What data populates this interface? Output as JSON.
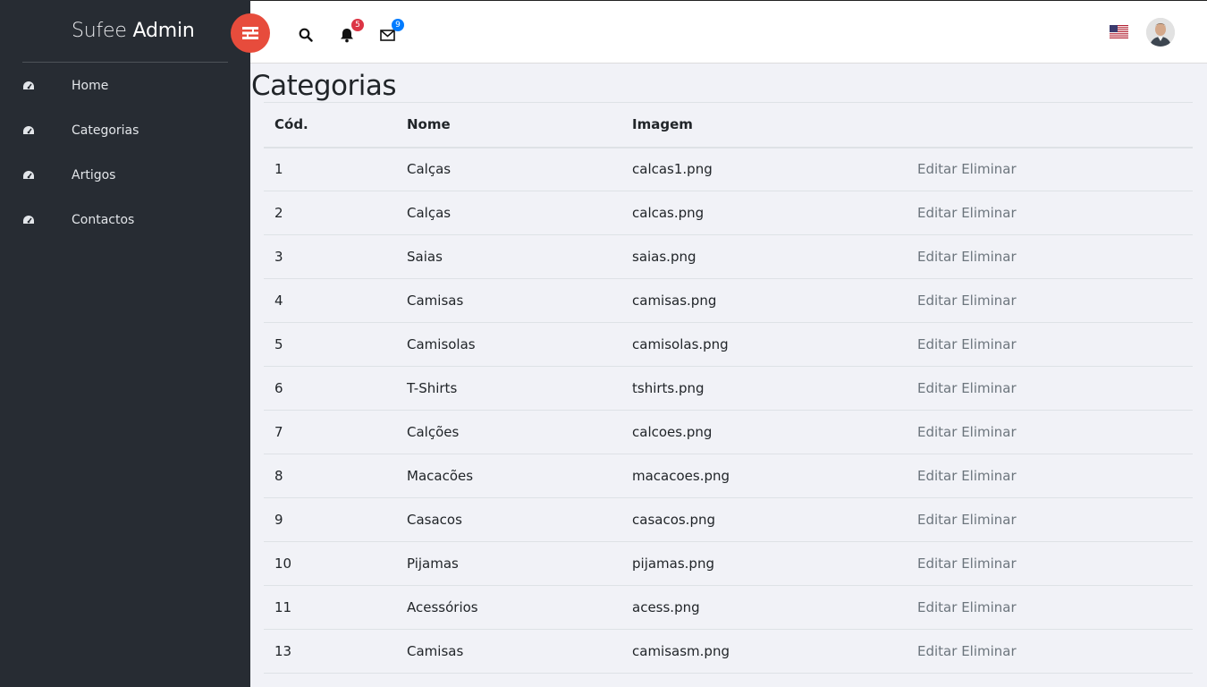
{
  "brand": {
    "light": "Sufee",
    "bold": "Admin"
  },
  "sidebar": {
    "items": [
      {
        "label": "Home",
        "icon": "dashboard-icon"
      },
      {
        "label": "Categorias",
        "icon": "dashboard-icon"
      },
      {
        "label": "Artigos",
        "icon": "dashboard-icon"
      },
      {
        "label": "Contactos",
        "icon": "dashboard-icon"
      }
    ]
  },
  "header": {
    "notifications_count": "5",
    "messages_count": "9",
    "badge_red": "#dc3545",
    "badge_blue": "#007bff",
    "language": "en-US"
  },
  "page": {
    "title": "Categorias"
  },
  "table": {
    "headers": [
      "Cód.",
      "Nome",
      "Imagem",
      ""
    ],
    "rows": [
      {
        "cod": "1",
        "nome": "Calças",
        "imagem": "calcas1.png"
      },
      {
        "cod": "2",
        "nome": "Calças",
        "imagem": "calcas.png"
      },
      {
        "cod": "3",
        "nome": "Saias",
        "imagem": "saias.png"
      },
      {
        "cod": "4",
        "nome": "Camisas",
        "imagem": "camisas.png"
      },
      {
        "cod": "5",
        "nome": "Camisolas",
        "imagem": "camisolas.png"
      },
      {
        "cod": "6",
        "nome": "T-Shirts",
        "imagem": "tshirts.png"
      },
      {
        "cod": "7",
        "nome": "Calções",
        "imagem": "calcoes.png"
      },
      {
        "cod": "8",
        "nome": "Macacões",
        "imagem": "macacoes.png"
      },
      {
        "cod": "9",
        "nome": "Casacos",
        "imagem": "casacos.png"
      },
      {
        "cod": "10",
        "nome": "Pijamas",
        "imagem": "pijamas.png"
      },
      {
        "cod": "11",
        "nome": "Acessórios",
        "imagem": "acess.png"
      },
      {
        "cod": "13",
        "nome": "Camisas",
        "imagem": "camisasm.png"
      }
    ],
    "edit_label": "Editar",
    "delete_label": "Eliminar"
  },
  "colors": {
    "sidebar_bg": "#272c33",
    "toggle_bg": "#e74c3c",
    "content_bg": "#f1f2f7"
  }
}
